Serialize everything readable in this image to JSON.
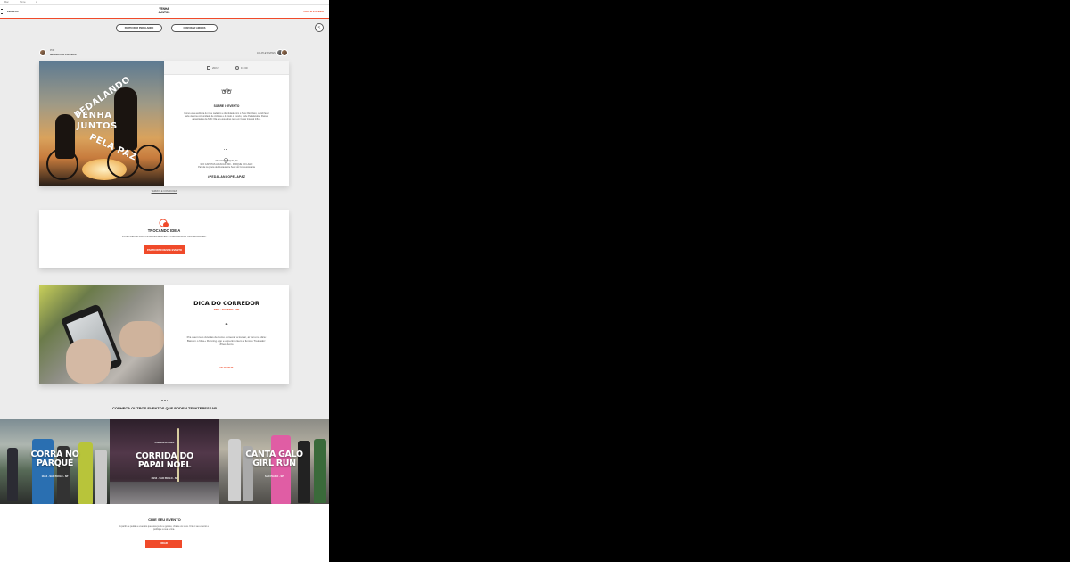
{
  "browser": {
    "tabs": [
      "Mac",
      "Home",
      "x"
    ]
  },
  "header": {
    "entrar": "ENTRAR",
    "logo_line1": "VENHA",
    "logo_line2": "JUNTOS",
    "criar_evento": "CRIAR EVENTO"
  },
  "actions": {
    "participar_label": "PARTICIPAR PEDALANDO",
    "convidar_label": "CONVIDAR AMIGOS",
    "share_icon": "share-icon"
  },
  "organizer": {
    "label": "POR",
    "name": "MARIA LUZ PASSOS"
  },
  "participants": {
    "label": "100 ATLETAS/PAIS"
  },
  "event": {
    "hero_title_line1": "PEDALANDO",
    "hero_title_line2": "VENHA",
    "hero_title_line3": "JUNTOS",
    "hero_title_line4": "PELA PAZ",
    "date": "20/12",
    "time": "15:30",
    "type": "CICLISMO",
    "about_title": "SOBRE O EVENTO",
    "about_text": "Como essa auditoria do meu cadastro e identidade com o Sesc Rio Claro, decidi fazer parte de uma comunidade de ciclistas e de todo o mundo, onde Pedalando e Passos capacitadas da NRC Vila no esquadrao pelo em Cesar Interval Influx.",
    "address_line1": "RUA DO PARQUE, 50",
    "address_line2": "RIO CAPOTAS ALFACAP, 300 - PARQUE DO LAGO",
    "address_line3": "Partida na praca de Restaurante Sesc do Concessionaria",
    "hashtag": "#PEDALANDOPELAPAZ",
    "terms": "TERMOS E CONDICOES"
  },
  "discussion": {
    "title": "TROCANDO IDEIA",
    "text": "VOCE PRECISA PARTICIPAR DESSE EVENTO PARA MANDAR UMA MENSAGEM.",
    "button": "PARTICIPAR DESSE EVENTO"
  },
  "tip": {
    "title": "DICA DO CORREDOR",
    "subtitle": "NIKE+ RUNNING APP",
    "quote_mark": "“",
    "text": "Pra quem tem duvidas de como comecar a treinar, ai vai uma dica: Baixem o Nike+ Running App e experimentem a funcao Treinador: #VemJunto",
    "link": "VEJA MAIS"
  },
  "others": {
    "heading": "CONHECA OUTROS EVENTOS QUE PODEM TE INTERESSAR",
    "events": [
      {
        "top": "",
        "title_line1": "CORRA NO",
        "title_line2": "PARQUE",
        "sub": "11/12 - SAO PAULO - SP"
      },
      {
        "top": "POR PAPAI NOEL",
        "title_line1": "CORRIDA DO",
        "title_line2": "PAPAI NOEL",
        "sub": "20/12 - SAO PAULO - SP"
      },
      {
        "top": "",
        "title_line1": "CANTA GALO",
        "title_line2": "GIRL RUN",
        "sub": "SAO PAULO - SP"
      }
    ]
  },
  "create": {
    "title": "CRIE SEU EVENTO",
    "text": "A partir de pedais e eventos que voce ja viu e gostou, chame os seus. Crie o seu evento e publique a sua turma.",
    "button": "CRIAR"
  },
  "colors": {
    "accent": "#f04a2a",
    "background": "#ececec"
  }
}
